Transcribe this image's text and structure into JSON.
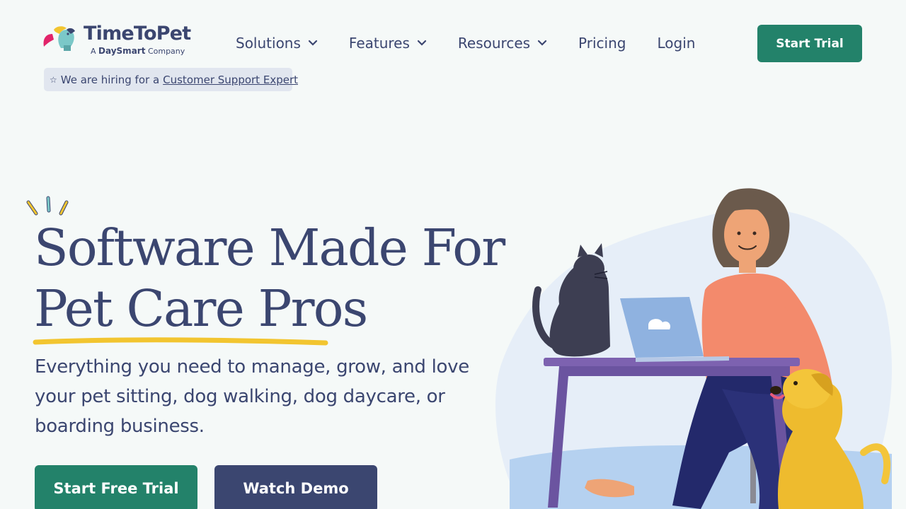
{
  "brand": {
    "name": "TimeToPet",
    "sub_prefix": "A",
    "sub_brand": "DaySmart",
    "sub_suffix": "Company"
  },
  "nav": {
    "items": [
      {
        "label": "Solutions",
        "dropdown": true
      },
      {
        "label": "Features",
        "dropdown": true
      },
      {
        "label": "Resources",
        "dropdown": true
      },
      {
        "label": "Pricing",
        "dropdown": false
      },
      {
        "label": "Login",
        "dropdown": false
      }
    ],
    "cta_label": "Start Trial"
  },
  "hiring": {
    "icon": "star-icon",
    "text": "We are hiring for a",
    "link_label": "Customer Support Expert"
  },
  "hero": {
    "title_line1": "Software Made For",
    "title_line2": "Pet Care Pros",
    "subtitle": "Everything you need to manage, grow, and love your pet sitting, dog walking, dog daycare, or boarding business.",
    "primary_cta": "Start Free Trial",
    "secondary_cta": "Watch Demo"
  },
  "colors": {
    "background": "#f5f9f8",
    "primary_green": "#23826a",
    "navy": "#3b4670",
    "accent_yellow": "#f2c530",
    "badge_bg": "#e1e6ef"
  }
}
